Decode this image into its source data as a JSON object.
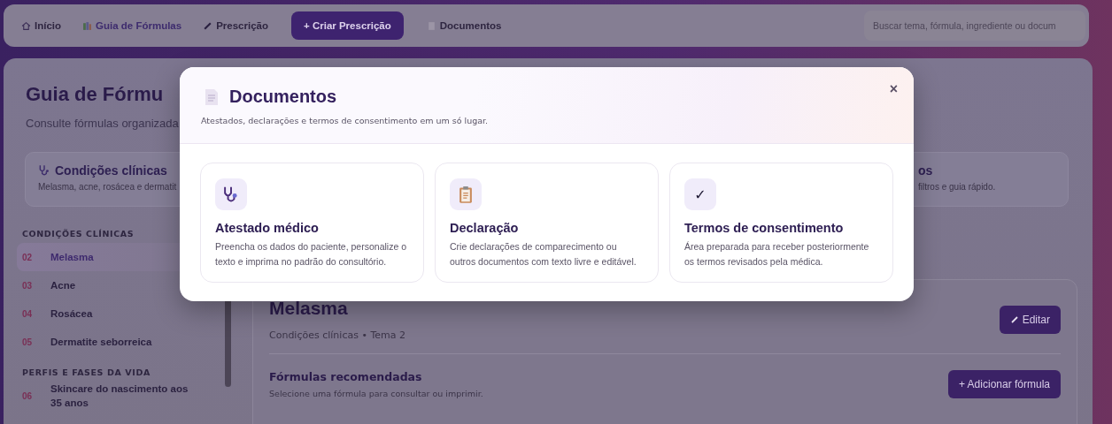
{
  "nav": {
    "tabs": [
      {
        "label": "Início",
        "kind": "link",
        "selected": false
      },
      {
        "label": "Guia de Fórmulas",
        "kind": "link",
        "selected": true
      },
      {
        "label": "Prescrição",
        "kind": "link",
        "selected": false
      },
      {
        "label": "+ Criar Prescrição",
        "kind": "primary",
        "selected": false
      },
      {
        "label": "Documentos",
        "kind": "link",
        "selected": false
      }
    ],
    "search": {
      "placeholder": "Buscar tema, fórmula, ingrediente ou docum"
    }
  },
  "page": {
    "title": "Guia de Fórmu",
    "subtitle": "Consulte fórmulas organizada",
    "feature_cards": [
      {
        "title": "Condições clínicas",
        "text": "Melasma, acne, rosácea e dermatit"
      },
      {
        "title": "os",
        "text": "filtros e guia rápido."
      }
    ]
  },
  "sidebar": {
    "groups": [
      {
        "heading": "CONDIÇÕES CLÍNICAS",
        "items": [
          {
            "number": "02",
            "label": "Melasma",
            "selected": true
          },
          {
            "number": "03",
            "label": "Acne",
            "selected": false
          },
          {
            "number": "04",
            "label": "Rosácea",
            "selected": false
          },
          {
            "number": "05",
            "label": "Dermatite seborreica",
            "selected": false
          }
        ]
      },
      {
        "heading": "PERFIS E FASES DA VIDA",
        "items": [
          {
            "number": "06",
            "label": "Skincare do nascimento aos 35 anos",
            "selected": false
          }
        ]
      }
    ]
  },
  "detail": {
    "title": "Melasma",
    "meta": "Condições clínicas • Tema 2",
    "edit_button": "Editar",
    "section_title": "Fórmulas recomendadas",
    "section_text": "Selecione uma fórmula para consultar ou imprimir.",
    "add_button": "+ Adicionar fórmula"
  },
  "modal": {
    "title": "Documentos",
    "subtitle": "Atestados, declarações e termos de consentimento em um só lugar.",
    "close": "×",
    "cards": [
      {
        "kind": "stethoscope",
        "title": "Atestado médico",
        "text": "Preencha os dados do paciente, personalize o texto e imprima no padrão do consultório."
      },
      {
        "kind": "clipboard",
        "title": "Declaração",
        "text": "Crie declarações de comparecimento ou outros documentos com texto livre e editável."
      },
      {
        "kind": "check",
        "title": "Termos de consentimento",
        "icon_text": "✓",
        "text": "Área preparada para receber posteriormente os termos revisados pela médica."
      }
    ]
  }
}
